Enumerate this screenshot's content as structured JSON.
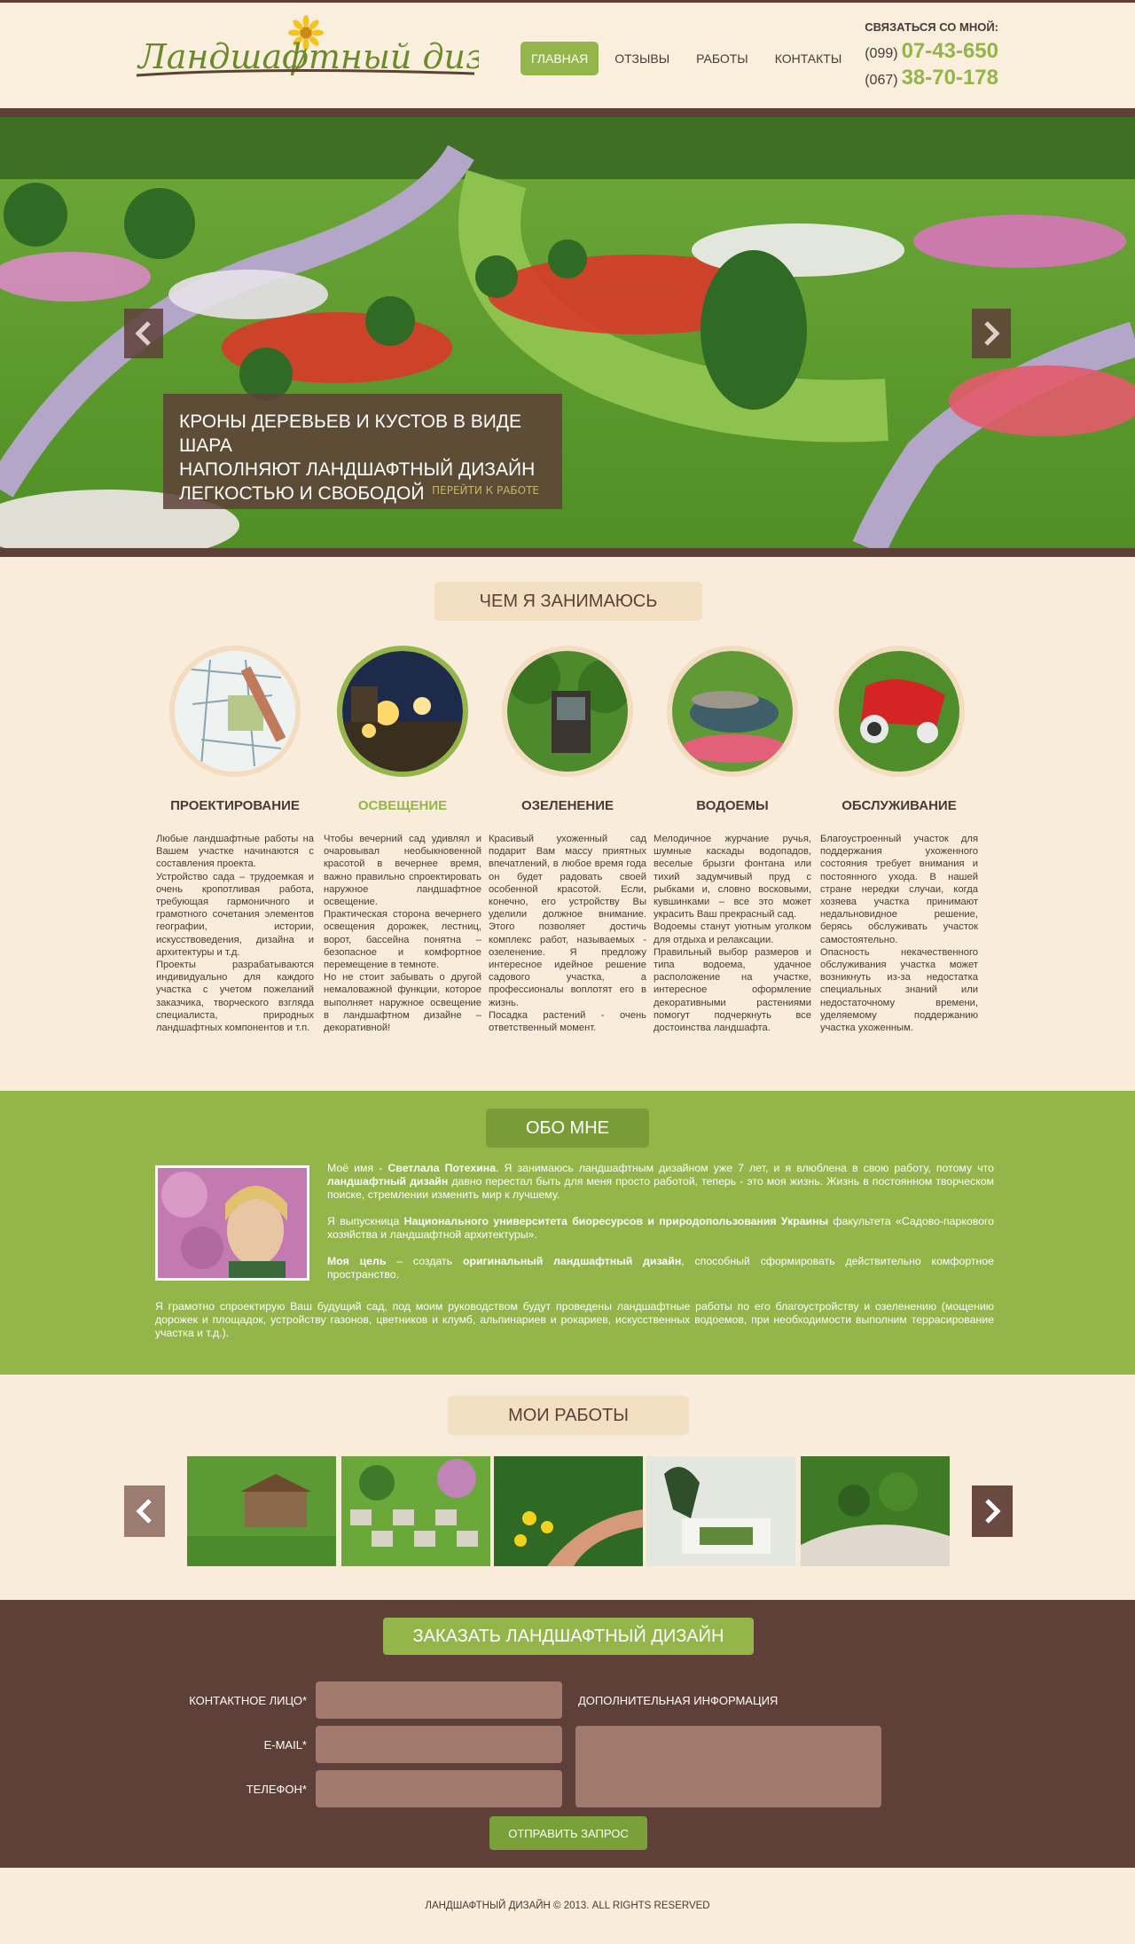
{
  "header": {
    "logo_text": "Ландшафтный дизайн",
    "nav": [
      {
        "label": "Главная",
        "active": true
      },
      {
        "label": "Отзывы"
      },
      {
        "label": "Работы"
      },
      {
        "label": "Контакты"
      }
    ],
    "contact_title": "Связаться со мной:",
    "phones": [
      {
        "code": "(099)",
        "number": "07-43-650"
      },
      {
        "code": "(067)",
        "number": "38-70-178"
      }
    ]
  },
  "slider": {
    "caption": "Кроны деревьев и кустов в виде шара\nнаполняют ландшафтный дизайн\nлегкостью и свободой",
    "link": "Перейти к работе"
  },
  "services": {
    "heading": "Чем я занимаюсь",
    "items": [
      {
        "title": "Проектирование",
        "text": "Любые ландшафтные работы на Вашем участке начинаются с составления проекта.\nУстройство сада – трудоемкая и очень кропотливая работа, требующая гармоничного и грамотного сочетания элементов географии, истории, искусствоведения, дизайна и архитектуры и т.д.\nПроекты разрабатываются индивидуально для каждого участка с учетом пожеланий заказчика, творческого взгляда специалиста, природных ландшафтных компонентов и т.п."
      },
      {
        "title": "Освещение",
        "active": true,
        "text": "Чтобы вечерний сад удивлял и очаровывал необыкновенной красотой в вечернее время, важно правильно спроектировать наружное ландшафтное освещение.\nПрактическая сторона вечернего освещения дорожек, лестниц, ворот, бассейна понятна – безопасное и комфортное перемещение в темноте.\nНо не стоит забывать о другой немаловажной функции, которое выполняет наружное освещение в ландшафтном дизайне – декоративной!"
      },
      {
        "title": "Озеленение",
        "text": "Красивый ухоженный сад подарит Вам массу приятных впечатлений, в любое время года он будет радовать своей особенной красотой. Если, конечно, его устройству Вы уделили должное внимание. Этого позволяет достичь комплекс работ, называемых - озеленение. Я предложу интересное идейное решение садового участка, а профессионалы воплотят его в жизнь.\nПосадка растений - очень ответственный момент."
      },
      {
        "title": "Водоемы",
        "text": "Мелодичное журчание ручья, шумные каскады водопадов, веселые брызги фонтана или тихий задумчивый пруд с рыбками и, словно восковыми, кувшинками – все это может украсить Ваш прекрасный сад.\nВодоемы станут уютным уголком для отдыха и релаксации.\nПравильный выбор размеров и типа водоема, удачное расположение на участке, интересное оформление декоративными растениями помогут подчеркнуть все достоинства ландшафта."
      },
      {
        "title": "Обслуживание",
        "text": "Благоустроенный участок для поддержания ухоженного состояния требует внимания и постоянного ухода. В нашей стране нередки случаи, когда хозяева участка принимают недальновидное решение, берясь обслуживать участок самостоятельно.\nОпасность некачественного обслуживания участка может возникнуть из-за недостатка специальных знаний или недостаточному времени, уделяемому поддержанию участка ухоженным."
      }
    ]
  },
  "about": {
    "heading": "Обо мне",
    "p1_a": "Моё имя - ",
    "p1_name": "Светлала Потехина",
    "p1_b": ". Я занимаюсь ландшафтным дизайном уже 7 лет, и я влюблена в свою работу, потому что ",
    "p1_bold": "ландшафтный дизайн",
    "p1_c": " давно перестал быть для меня просто работой, теперь - это моя жизнь. Жизнь в постоянном творческом поиске, стремлении изменить мир к лучшему.",
    "p2_a": "Я выпускница ",
    "p2_bold": "Национального университета биоресурсов и природопользования Украины",
    "p2_b": " факультета «Садово-паркового хозяйства и ландшафтной архитектуры».",
    "p3_bold1": "Моя цель",
    "p3_a": " – создать ",
    "p3_bold2": "оригинальный ландшафтный дизайн",
    "p3_b": ", способный сформировать действительно комфортное пространство.",
    "bottom": "Я грамотно спроектирую Ваш будущий сад, под моим руководством будут проведены ландшафтные работы по его благоустройству и озеленению (мощению дорожек и площадок, устройству газонов, цветников и клумб, альпинариев и рокариев, искусственных водоемов, при необходимости выполним террасирование участка и т.д.)."
  },
  "works": {
    "heading": "Мои работы"
  },
  "order": {
    "button": "Заказать ландшафтный дизайн",
    "labels": {
      "contact": "Контактное лицо*",
      "email": "E-mail*",
      "phone": "Телефон*",
      "extra": "Дополнительная информация"
    },
    "submit": "Отправить запрос"
  },
  "footer": {
    "text": "Ландшафтный дизайн © 2013. All rights reserved"
  },
  "colors": {
    "accent": "#94b54a",
    "brown": "#5e4038",
    "cream": "#f9ecda"
  }
}
